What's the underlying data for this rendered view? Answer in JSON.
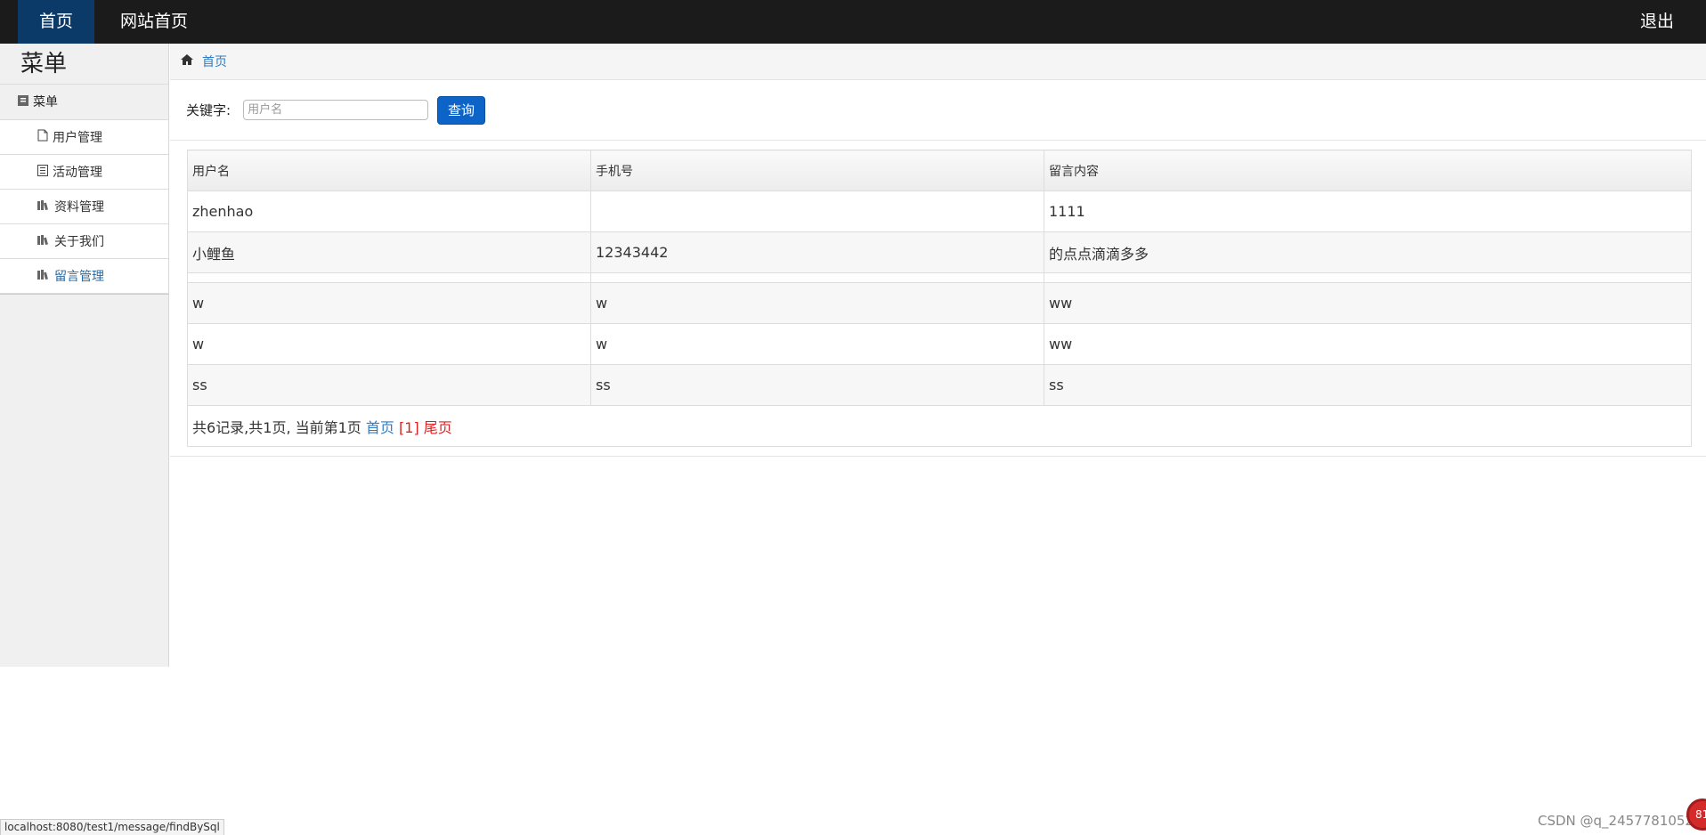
{
  "topbar": {
    "home": "首页",
    "site_home": "网站首页",
    "logout": "退出"
  },
  "sidebar": {
    "title": "菜单",
    "header": "菜单",
    "items": [
      {
        "label": "用户管理",
        "icon": "file-icon",
        "active": false
      },
      {
        "label": "活动管理",
        "icon": "list-icon",
        "active": false
      },
      {
        "label": "资料管理",
        "icon": "books-icon",
        "active": false
      },
      {
        "label": "关于我们",
        "icon": "books-icon",
        "active": false
      },
      {
        "label": "留言管理",
        "icon": "books-icon",
        "active": true
      }
    ]
  },
  "breadcrumb": {
    "icon": "home-icon",
    "label": "首页"
  },
  "search": {
    "label": "关键字:",
    "placeholder": "用户名",
    "button": "查询"
  },
  "table": {
    "headers": [
      "用户名",
      "手机号",
      "留言内容"
    ],
    "rows": [
      {
        "username": "zhenhao",
        "phone": "",
        "content": "1111"
      },
      {
        "username": "小鲤鱼",
        "phone": "12343442",
        "content": "的点点滴滴多多"
      },
      {
        "username": "",
        "phone": "",
        "content": ""
      },
      {
        "username": "w",
        "phone": "w",
        "content": "ww"
      },
      {
        "username": "w",
        "phone": "w",
        "content": "ww"
      },
      {
        "username": "ss",
        "phone": "ss",
        "content": "ss"
      }
    ]
  },
  "pager": {
    "summary": "共6记录,共1页, 当前第1页",
    "first": "首页",
    "current": "[1]",
    "last": "尾页"
  },
  "statusbar": {
    "url": "localhost:8080/test1/message/findBySql"
  },
  "watermark": "CSDN @q_2457781052",
  "float_badge": "81",
  "colors": {
    "topbar_bg": "#1b1b1b",
    "active_tab": "#0b3a69",
    "link_blue": "#2f7dc5",
    "link_red": "#e02020",
    "button_blue": "#0d64c8"
  }
}
